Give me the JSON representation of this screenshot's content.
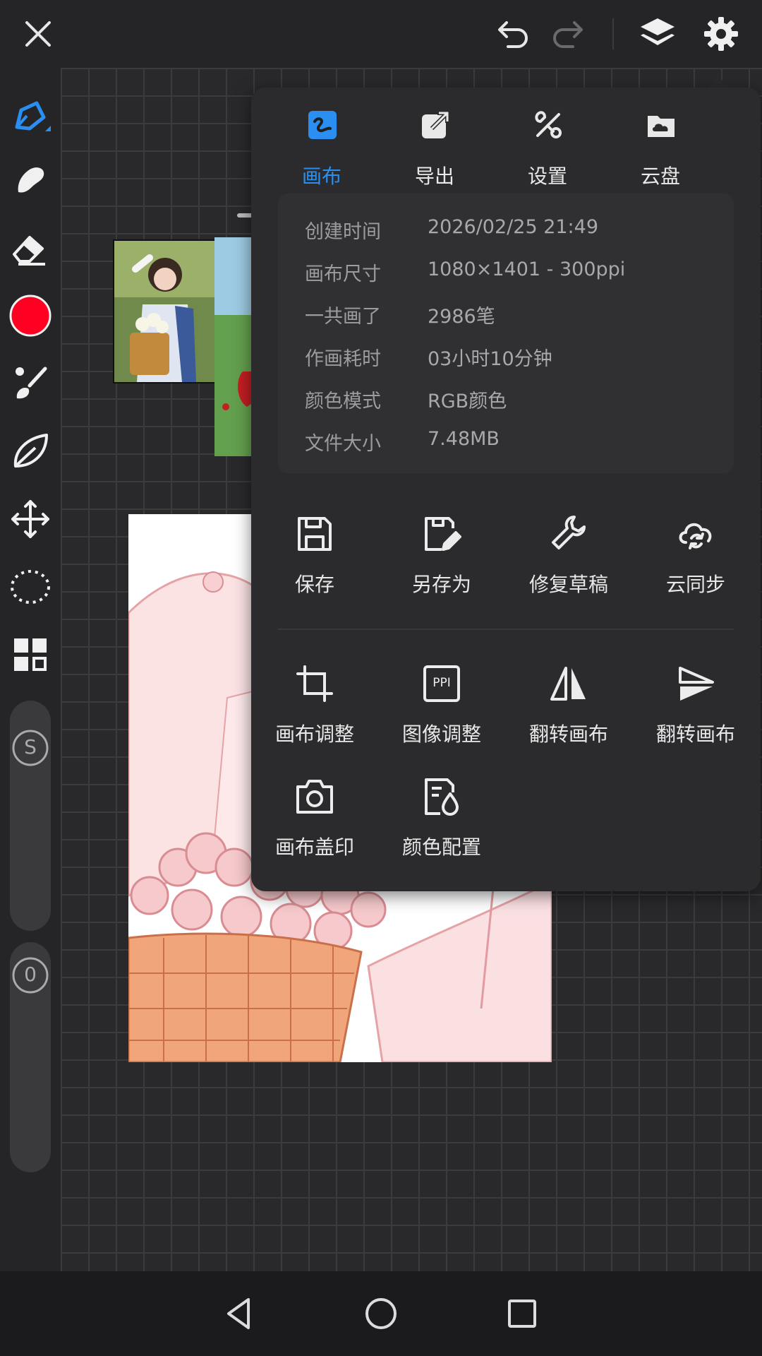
{
  "topbar": {
    "close_icon": "close-icon",
    "undo_icon": "undo-icon",
    "redo_icon": "redo-icon",
    "layers_icon": "layers-icon",
    "settings_icon": "gear-icon"
  },
  "lefttools": {
    "current_color": "#ff0022",
    "size_slider_label": "S",
    "opacity_slider_label": "0"
  },
  "panel": {
    "tabs": [
      {
        "label": "画布",
        "icon": "canvas-icon",
        "active": true
      },
      {
        "label": "导出",
        "icon": "export-icon",
        "active": false
      },
      {
        "label": "设置",
        "icon": "tools-icon",
        "active": false
      },
      {
        "label": "云盘",
        "icon": "cloud-drive-icon",
        "active": false
      }
    ],
    "info": [
      {
        "key": "创建时间",
        "value": "2026/02/25 21:49"
      },
      {
        "key": "画布尺寸",
        "value": "1080×1401 - 300ppi"
      },
      {
        "key": "一共画了",
        "value": "2986笔"
      },
      {
        "key": "作画耗时",
        "value": "03小时10分钟"
      },
      {
        "key": "颜色模式",
        "value": "RGB颜色"
      },
      {
        "key": "文件大小",
        "value": "7.48MB"
      }
    ],
    "actions_row1": [
      {
        "label": "保存",
        "icon": "save-icon"
      },
      {
        "label": "另存为",
        "icon": "save-as-icon"
      },
      {
        "label": "修复草稿",
        "icon": "wrench-icon"
      },
      {
        "label": "云同步",
        "icon": "cloud-sync-icon"
      }
    ],
    "actions_row2": [
      {
        "label": "画布调整",
        "icon": "crop-icon"
      },
      {
        "label": "图像调整",
        "icon": "ppi-icon",
        "icon_text": "PPI"
      },
      {
        "label": "翻转画布",
        "icon": "flip-horizontal-icon"
      },
      {
        "label": "翻转画布",
        "icon": "flip-vertical-icon"
      }
    ],
    "actions_row3": [
      {
        "label": "画布盖印",
        "icon": "camera-icon"
      },
      {
        "label": "颜色配置",
        "icon": "color-profile-icon"
      }
    ]
  },
  "colors": {
    "accent": "#2a8ff0",
    "panel_bg": "#2b2b2d",
    "brush_color": "#ff0022"
  }
}
